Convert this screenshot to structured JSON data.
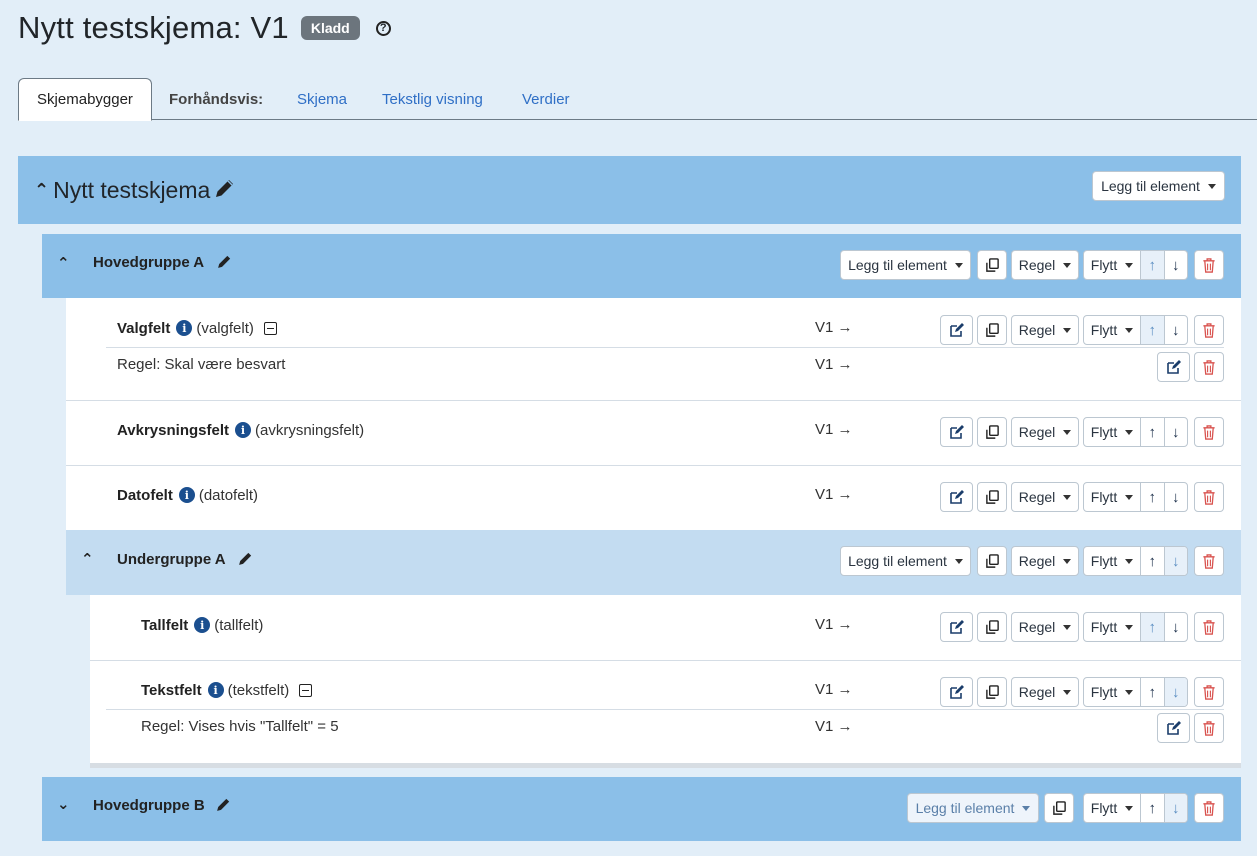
{
  "header": {
    "title": "Nytt testskjema: V1",
    "badge": "Kladd",
    "help_icon": "?"
  },
  "tabs": {
    "builder": "Skjemabygger",
    "preview_label": "Forhåndsvis:",
    "schema": "Skjema",
    "text_view": "Tekstlig visning",
    "values": "Verdier"
  },
  "root": {
    "title": "Nytt testskjema",
    "add_element": "Legg til element"
  },
  "labels": {
    "add_element": "Legg til element",
    "rule": "Regel",
    "move": "Flytt",
    "version": "V1 →",
    "up": "↑",
    "down": "↓"
  },
  "groups": {
    "a": {
      "title": "Hovedgruppe A"
    },
    "sub_a": {
      "title": "Undergruppe A"
    },
    "b": {
      "title": "Hovedgruppe B"
    }
  },
  "fields": [
    {
      "title": "Valgfelt",
      "type": "(valgfelt)",
      "rule": "Regel: Skal være besvart"
    },
    {
      "title": "Avkrysningsfelt",
      "type": "(avkrysningsfelt)"
    },
    {
      "title": "Datofelt",
      "type": "(datofelt)"
    },
    {
      "title": "Tallfelt",
      "type": "(tallfelt)"
    },
    {
      "title": "Tekstfelt",
      "type": "(tekstfelt)",
      "rule": "Regel: Vises hvis \"Tallfelt\" = 5"
    }
  ],
  "colors": {
    "band_main": "#8bbfe8",
    "band_sub": "#c3dcf1",
    "delete": "#d9534f",
    "info": "#1b4f8f",
    "link": "#2f6fc6"
  }
}
